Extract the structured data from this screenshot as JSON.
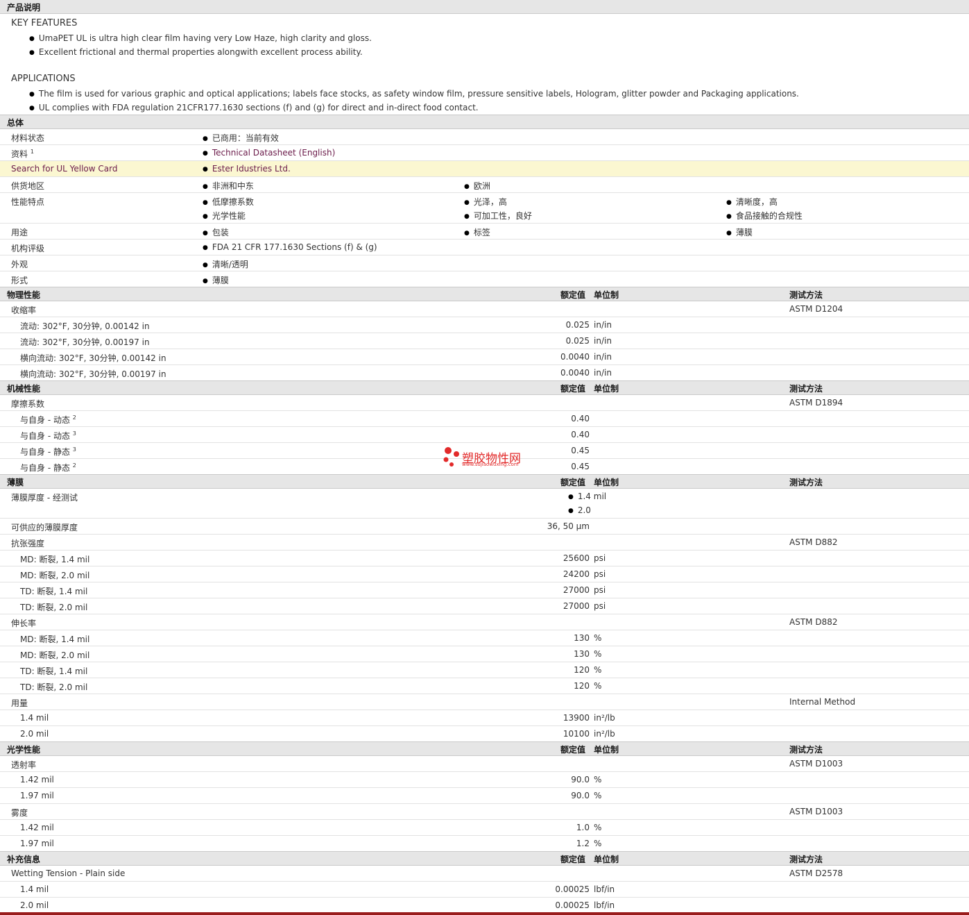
{
  "product_desc": {
    "header": "产品说明",
    "key_features_title": "KEY FEATURES",
    "key_features": [
      "UmaPET UL is ultra high clear film having very Low Haze, high clarity and gloss.",
      "Excellent frictional and thermal properties alongwith excellent process ability."
    ],
    "applications_title": "APPLICATIONS",
    "applications": [
      "The film is used for various graphic and optical applications; labels face stocks, as safety window film, pressure sensitive labels, Hologram, glitter powder and Packaging applications.",
      "UL complies with FDA regulation 21CFR177.1630 sections (f) and (g) for direct and in-direct food contact."
    ]
  },
  "general": {
    "header": "总体",
    "material_status_label": "材料状态",
    "material_status_value": "已商用：当前有效",
    "docs_label": "资料",
    "docs_sup": "1",
    "docs_value": "Technical Datasheet (English)",
    "ul_label": "Search for UL Yellow Card",
    "ul_value": "Ester Idustries Ltd.",
    "regions_label": "供货地区",
    "regions": [
      "非洲和中东",
      "欧洲"
    ],
    "features_label": "性能特点",
    "features": [
      "低摩擦系数",
      "光泽，高",
      "清晰度，高",
      "光学性能",
      "可加工性，良好",
      "食品接触的合规性"
    ],
    "uses_label": "用途",
    "uses": [
      "包装",
      "标签",
      "薄膜"
    ],
    "agency_label": "机构评级",
    "agency_value": "FDA 21 CFR 177.1630 Sections (f) & (g)",
    "appearance_label": "外观",
    "appearance_value": "清晰/透明",
    "form_label": "形式",
    "form_value": "薄膜"
  },
  "columns": {
    "nominal": "额定值",
    "unit": "单位制",
    "method": "测试方法"
  },
  "physical": {
    "header": "物理性能",
    "prop": "收缩率",
    "method": "ASTM D1204",
    "rows": [
      {
        "label": "流动: 302°F, 30分钟, 0.00142 in",
        "value": "0.025",
        "unit": "in/in"
      },
      {
        "label": "流动: 302°F, 30分钟, 0.00197 in",
        "value": "0.025",
        "unit": "in/in"
      },
      {
        "label": "横向流动: 302°F, 30分钟, 0.00142 in",
        "value": "0.0040",
        "unit": "in/in"
      },
      {
        "label": "横向流动: 302°F, 30分钟, 0.00197 in",
        "value": "0.0040",
        "unit": "in/in"
      }
    ]
  },
  "mechanical": {
    "header": "机械性能",
    "prop": "摩擦系数",
    "method": "ASTM D1894",
    "rows": [
      {
        "label": "与自身 - 动态",
        "sup": "2",
        "value": "0.40"
      },
      {
        "label": "与自身 - 动态",
        "sup": "3",
        "value": "0.40"
      },
      {
        "label": "与自身 - 静态",
        "sup": "3",
        "value": "0.45"
      },
      {
        "label": "与自身 - 静态",
        "sup": "2",
        "value": "0.45"
      }
    ]
  },
  "film": {
    "header": "薄膜",
    "thickness_label": "薄膜厚度 - 经测试",
    "thickness_values": [
      "1.4 mil",
      "2.0"
    ],
    "available_label": "可供应的薄膜厚度",
    "available_value": "36, 50 µm",
    "tensile_label": "抗张强度",
    "tensile_method": "ASTM D882",
    "tensile": [
      {
        "label": "MD: 断裂, 1.4 mil",
        "value": "25600",
        "unit": "psi"
      },
      {
        "label": "MD: 断裂, 2.0 mil",
        "value": "24200",
        "unit": "psi"
      },
      {
        "label": "TD: 断裂, 1.4 mil",
        "value": "27000",
        "unit": "psi"
      },
      {
        "label": "TD: 断裂, 2.0 mil",
        "value": "27000",
        "unit": "psi"
      }
    ],
    "elong_label": "伸长率",
    "elong_method": "ASTM D882",
    "elong": [
      {
        "label": "MD: 断裂, 1.4 mil",
        "value": "130",
        "unit": "%"
      },
      {
        "label": "MD: 断裂, 2.0 mil",
        "value": "130",
        "unit": "%"
      },
      {
        "label": "TD: 断裂, 1.4 mil",
        "value": "120",
        "unit": "%"
      },
      {
        "label": "TD: 断裂, 2.0 mil",
        "value": "120",
        "unit": "%"
      }
    ],
    "yield_label": "用量",
    "yield_method": "Internal Method",
    "yield": [
      {
        "label": "1.4 mil",
        "value": "13900",
        "unit": "in²/lb"
      },
      {
        "label": "2.0 mil",
        "value": "10100",
        "unit": "in²/lb"
      }
    ]
  },
  "optical": {
    "header": "光学性能",
    "trans_label": "透射率",
    "trans_method": "ASTM D1003",
    "trans": [
      {
        "label": "1.42 mil",
        "value": "90.0",
        "unit": "%"
      },
      {
        "label": "1.97 mil",
        "value": "90.0",
        "unit": "%"
      }
    ],
    "haze_label": "雾度",
    "haze_method": "ASTM D1003",
    "haze": [
      {
        "label": "1.42 mil",
        "value": "1.0",
        "unit": "%"
      },
      {
        "label": "1.97 mil",
        "value": "1.2",
        "unit": "%"
      }
    ]
  },
  "additional": {
    "header": "补充信息",
    "wet_label": "Wetting Tension - Plain side",
    "wet_method": "ASTM D2578",
    "wet": [
      {
        "label": "1.4 mil",
        "value": "0.00025",
        "unit": "lbf/in"
      },
      {
        "label": "2.0 mil",
        "value": "0.00025",
        "unit": "lbf/in"
      }
    ]
  },
  "watermark": {
    "text": "塑胶物性网",
    "url": "www.sujiaowuxing.com"
  }
}
